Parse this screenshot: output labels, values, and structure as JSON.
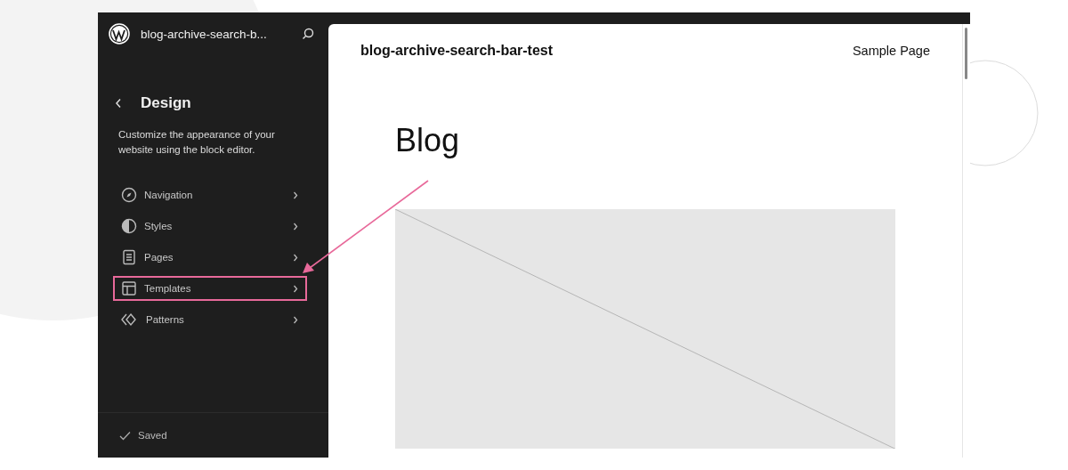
{
  "sidebar": {
    "site_title": "blog-archive-search-b...",
    "section": {
      "title": "Design",
      "description": "Customize the appearance of your website using the block editor."
    },
    "items": [
      {
        "label": "Navigation",
        "kind": "navigation",
        "highlighted": false
      },
      {
        "label": "Styles",
        "kind": "styles",
        "highlighted": false
      },
      {
        "label": "Pages",
        "kind": "pages",
        "highlighted": false
      },
      {
        "label": "Templates",
        "kind": "templates",
        "highlighted": true
      },
      {
        "label": "Patterns",
        "kind": "patterns",
        "highlighted": false
      }
    ],
    "status": "Saved"
  },
  "preview": {
    "site_title": "blog-archive-search-bar-test",
    "nav_link": "Sample Page",
    "heading": "Blog"
  }
}
